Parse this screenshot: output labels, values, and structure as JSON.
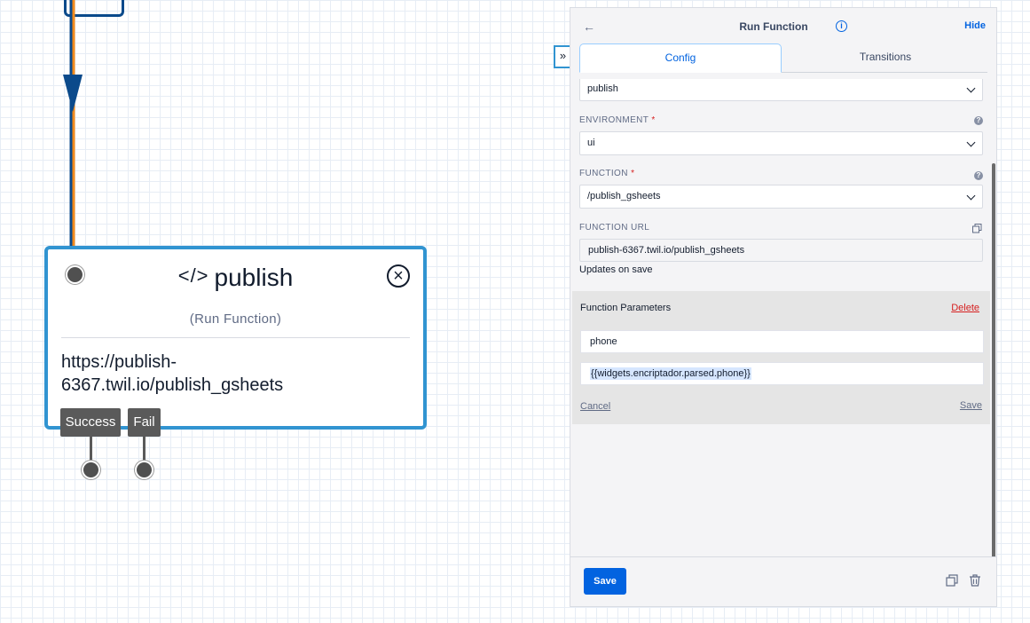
{
  "canvas": {
    "widget": {
      "title": "publish",
      "title_glyph": "</>",
      "subtitle": "(Run Function)",
      "url_line1": "https://publish-",
      "url_line2": "6367.twil.io/publish_gsheets"
    },
    "transitions": [
      {
        "label": "Success"
      },
      {
        "label": "Fail"
      }
    ],
    "expand_glyph": "»",
    "colors": {
      "node_border": "#3194d1",
      "flow_line": "#0b4a8b",
      "accent_line": "#f28a1c"
    }
  },
  "panel": {
    "title": "Run Function",
    "back_icon": "←",
    "info_icon": "i",
    "hide_label": "Hide",
    "tabs": [
      {
        "label": "Config",
        "active": true
      },
      {
        "label": "Transitions",
        "active": false
      }
    ],
    "service": {
      "value": "publish"
    },
    "environment": {
      "label": "ENVIRONMENT",
      "required": "*",
      "value": "ui"
    },
    "function": {
      "label": "FUNCTION",
      "required": "*",
      "value": "/publish_gsheets"
    },
    "function_url": {
      "label": "FUNCTION URL",
      "value": "publish-6367.twil.io/publish_gsheets",
      "note": "Updates on save"
    },
    "help_icon": "?",
    "parameters": {
      "title": "Function Parameters",
      "delete_label": "Delete",
      "key": "phone",
      "value": "{{widgets.encriptador.parsed.phone}}",
      "cancel_label": "Cancel",
      "save_label": "Save"
    },
    "footer": {
      "save_label": "Save"
    }
  }
}
